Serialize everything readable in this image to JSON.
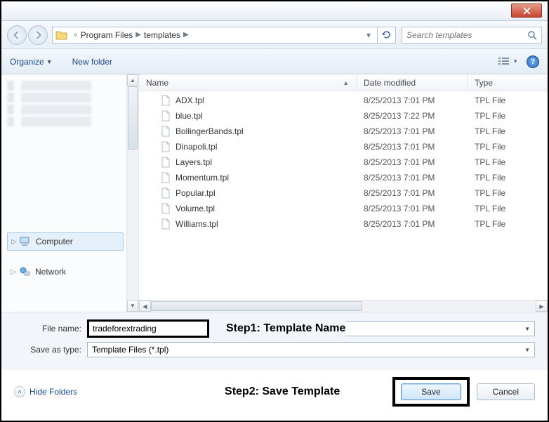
{
  "breadcrumb": {
    "item1": "Program Files",
    "item2": "templates"
  },
  "search": {
    "placeholder": "Search templates"
  },
  "toolbar": {
    "organize": "Organize",
    "newfolder": "New folder"
  },
  "columns": {
    "name": "Name",
    "date": "Date modified",
    "type": "Type"
  },
  "files": [
    {
      "name": "ADX.tpl",
      "date": "8/25/2013 7:01 PM",
      "type": "TPL File"
    },
    {
      "name": "blue.tpl",
      "date": "8/25/2013 7:22 PM",
      "type": "TPL File"
    },
    {
      "name": "BollingerBands.tpl",
      "date": "8/25/2013 7:01 PM",
      "type": "TPL File"
    },
    {
      "name": "Dinapoli.tpl",
      "date": "8/25/2013 7:01 PM",
      "type": "TPL File"
    },
    {
      "name": "Layers.tpl",
      "date": "8/25/2013 7:01 PM",
      "type": "TPL File"
    },
    {
      "name": "Momentum.tpl",
      "date": "8/25/2013 7:01 PM",
      "type": "TPL File"
    },
    {
      "name": "Popular.tpl",
      "date": "8/25/2013 7:01 PM",
      "type": "TPL File"
    },
    {
      "name": "Volume.tpl",
      "date": "8/25/2013 7:01 PM",
      "type": "TPL File"
    },
    {
      "name": "Williams.tpl",
      "date": "8/25/2013 7:01 PM",
      "type": "TPL File"
    }
  ],
  "sidebar": {
    "computer": "Computer",
    "network": "Network"
  },
  "form": {
    "filename_label": "File name:",
    "filename_value": "tradeforextrading",
    "saveas_label": "Save as type:",
    "saveas_value": "Template Files (*.tpl)"
  },
  "annotations": {
    "step1": "Step1: Template Name",
    "step2": "Step2: Save Template"
  },
  "footer": {
    "hide_folders": "Hide Folders",
    "save": "Save",
    "cancel": "Cancel"
  }
}
